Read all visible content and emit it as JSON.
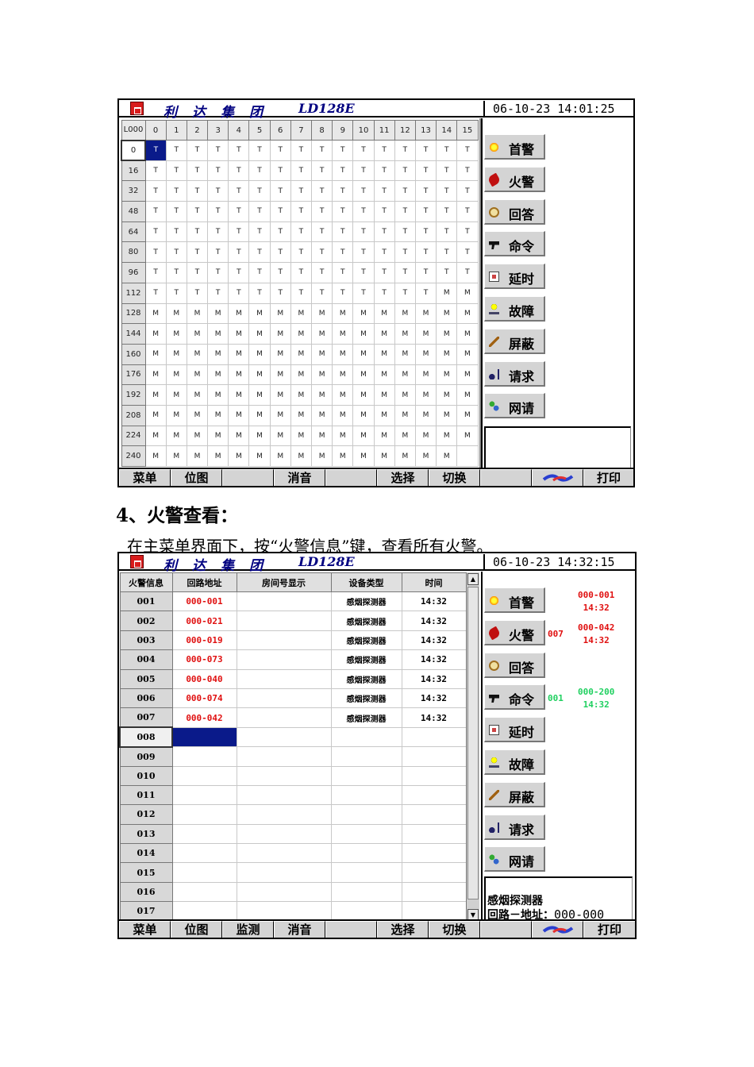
{
  "title_group": "利达集团",
  "title_model": "LD128E",
  "screen1": {
    "datetime": "06-10-23 14:01:25",
    "corner_label": "L000",
    "col_headers": [
      "0",
      "1",
      "2",
      "3",
      "4",
      "5",
      "6",
      "7",
      "8",
      "9",
      "10",
      "11",
      "12",
      "13",
      "14",
      "15"
    ],
    "row_labels": [
      "0",
      "16",
      "32",
      "48",
      "64",
      "80",
      "96",
      "112",
      "128",
      "144",
      "160",
      "176",
      "192",
      "208",
      "224",
      "240"
    ],
    "rows": [
      [
        "T",
        "T",
        "T",
        "T",
        "T",
        "T",
        "T",
        "T",
        "T",
        "T",
        "T",
        "T",
        "T",
        "T",
        "T",
        "T"
      ],
      [
        "T",
        "T",
        "T",
        "T",
        "T",
        "T",
        "T",
        "T",
        "T",
        "T",
        "T",
        "T",
        "T",
        "T",
        "T",
        "T"
      ],
      [
        "T",
        "T",
        "T",
        "T",
        "T",
        "T",
        "T",
        "T",
        "T",
        "T",
        "T",
        "T",
        "T",
        "T",
        "T",
        "T"
      ],
      [
        "T",
        "T",
        "T",
        "T",
        "T",
        "T",
        "T",
        "T",
        "T",
        "T",
        "T",
        "T",
        "T",
        "T",
        "T",
        "T"
      ],
      [
        "T",
        "T",
        "T",
        "T",
        "T",
        "T",
        "T",
        "T",
        "T",
        "T",
        "T",
        "T",
        "T",
        "T",
        "T",
        "T"
      ],
      [
        "T",
        "T",
        "T",
        "T",
        "T",
        "T",
        "T",
        "T",
        "T",
        "T",
        "T",
        "T",
        "T",
        "T",
        "T",
        "T"
      ],
      [
        "T",
        "T",
        "T",
        "T",
        "T",
        "T",
        "T",
        "T",
        "T",
        "T",
        "T",
        "T",
        "T",
        "T",
        "T",
        "T"
      ],
      [
        "T",
        "T",
        "T",
        "T",
        "T",
        "T",
        "T",
        "T",
        "T",
        "T",
        "T",
        "T",
        "T",
        "T",
        "M",
        "M"
      ],
      [
        "M",
        "M",
        "M",
        "M",
        "M",
        "M",
        "M",
        "M",
        "M",
        "M",
        "M",
        "M",
        "M",
        "M",
        "M",
        "M"
      ],
      [
        "M",
        "M",
        "M",
        "M",
        "M",
        "M",
        "M",
        "M",
        "M",
        "M",
        "M",
        "M",
        "M",
        "M",
        "M",
        "M"
      ],
      [
        "M",
        "M",
        "M",
        "M",
        "M",
        "M",
        "M",
        "M",
        "M",
        "M",
        "M",
        "M",
        "M",
        "M",
        "M",
        "M"
      ],
      [
        "M",
        "M",
        "M",
        "M",
        "M",
        "M",
        "M",
        "M",
        "M",
        "M",
        "M",
        "M",
        "M",
        "M",
        "M",
        "M"
      ],
      [
        "M",
        "M",
        "M",
        "M",
        "M",
        "M",
        "M",
        "M",
        "M",
        "M",
        "M",
        "M",
        "M",
        "M",
        "M",
        "M"
      ],
      [
        "M",
        "M",
        "M",
        "M",
        "M",
        "M",
        "M",
        "M",
        "M",
        "M",
        "M",
        "M",
        "M",
        "M",
        "M",
        "M"
      ],
      [
        "M",
        "M",
        "M",
        "M",
        "M",
        "M",
        "M",
        "M",
        "M",
        "M",
        "M",
        "M",
        "M",
        "M",
        "M",
        "M"
      ],
      [
        "M",
        "M",
        "M",
        "M",
        "M",
        "M",
        "M",
        "M",
        "M",
        "M",
        "M",
        "M",
        "M",
        "M",
        "M",
        ""
      ]
    ],
    "bottom_buttons": [
      "菜单",
      "位图",
      "",
      "消音",
      "",
      "选择",
      "切换",
      "",
      "",
      "打印"
    ]
  },
  "side_buttons": [
    {
      "label": "首警",
      "icon": "first-alarm-icon"
    },
    {
      "label": "火警",
      "icon": "fire-alarm-icon"
    },
    {
      "label": "回答",
      "icon": "answer-icon"
    },
    {
      "label": "命令",
      "icon": "command-icon"
    },
    {
      "label": "延时",
      "icon": "delay-icon"
    },
    {
      "label": "故障",
      "icon": "fault-icon"
    },
    {
      "label": "屏蔽",
      "icon": "shield-icon"
    },
    {
      "label": "请求",
      "icon": "request-icon"
    },
    {
      "label": "网请",
      "icon": "network-request-icon"
    }
  ],
  "doc": {
    "heading": "4、火警查看：",
    "paragraph": "在主菜单界面下，按“火警信息”键，查看所有火警。"
  },
  "screen2": {
    "datetime": "06-10-23 14:32:15",
    "headers": [
      "火警信息",
      "回路地址",
      "房间号显示",
      "设备类型",
      "时间"
    ],
    "rows": [
      {
        "num": "001",
        "addr": "000-001",
        "room": "",
        "dev": "感烟探测器",
        "time": "14:32"
      },
      {
        "num": "002",
        "addr": "000-021",
        "room": "",
        "dev": "感烟探测器",
        "time": "14:32"
      },
      {
        "num": "003",
        "addr": "000-019",
        "room": "",
        "dev": "感烟探测器",
        "time": "14:32"
      },
      {
        "num": "004",
        "addr": "000-073",
        "room": "",
        "dev": "感烟探测器",
        "time": "14:32"
      },
      {
        "num": "005",
        "addr": "000-040",
        "room": "",
        "dev": "感烟探测器",
        "time": "14:32"
      },
      {
        "num": "006",
        "addr": "000-074",
        "room": "",
        "dev": "感烟探测器",
        "time": "14:32"
      },
      {
        "num": "007",
        "addr": "000-042",
        "room": "",
        "dev": "感烟探测器",
        "time": "14:32"
      },
      {
        "num": "008",
        "addr": "",
        "room": "",
        "dev": "",
        "time": ""
      },
      {
        "num": "009",
        "addr": "",
        "room": "",
        "dev": "",
        "time": ""
      },
      {
        "num": "010",
        "addr": "",
        "room": "",
        "dev": "",
        "time": ""
      },
      {
        "num": "011",
        "addr": "",
        "room": "",
        "dev": "",
        "time": ""
      },
      {
        "num": "012",
        "addr": "",
        "room": "",
        "dev": "",
        "time": ""
      },
      {
        "num": "013",
        "addr": "",
        "room": "",
        "dev": "",
        "time": ""
      },
      {
        "num": "014",
        "addr": "",
        "room": "",
        "dev": "",
        "time": ""
      },
      {
        "num": "015",
        "addr": "",
        "room": "",
        "dev": "",
        "time": ""
      },
      {
        "num": "016",
        "addr": "",
        "room": "",
        "dev": "",
        "time": ""
      },
      {
        "num": "017",
        "addr": "",
        "room": "",
        "dev": "",
        "time": ""
      }
    ],
    "first_alarm": {
      "addr": "000-001",
      "time": "14:32"
    },
    "fire_count": "007",
    "last_fire": {
      "addr": "000-042",
      "time": "14:32"
    },
    "other_count": "001",
    "other_alarm": {
      "addr": "000-200",
      "time": "14:32"
    },
    "info_device": "感烟探测器",
    "info_loop_label": "回路－地址：",
    "info_loop_value": "000-000",
    "bottom_buttons": [
      "菜单",
      "位图",
      "监测",
      "消音",
      "",
      "选择",
      "切换",
      "",
      "",
      "打印"
    ]
  },
  "colors": {
    "accent_blue": "#0a1a8a",
    "alarm_red": "#e01010",
    "alarm_green": "#20d060",
    "title_blue": "#000080"
  }
}
